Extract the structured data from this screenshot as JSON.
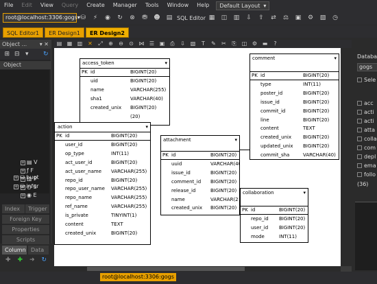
{
  "menu": [
    "File",
    "Edit",
    "View",
    "Query",
    "Create",
    "Manager",
    "Tools",
    "Window",
    "Help"
  ],
  "menu_disabled": [
    false,
    true,
    false,
    true,
    false,
    false,
    false,
    false,
    false
  ],
  "layout_select": "Default Layout",
  "connection": "root@localhost:3306:gogs",
  "sql_editor_label": "SQL Editor",
  "tabs": [
    "SQL Editor1",
    "ER Design1",
    "ER Design2"
  ],
  "object_panel": {
    "title": "Object ...",
    "tree_header": "Object",
    "tree_items": [
      "V",
      "F",
      "P",
      "S",
      "E",
      "bugt",
      "infor"
    ],
    "tabs": [
      "Index",
      "Trigger",
      "Foreign Key",
      "Properties",
      "Scripts"
    ],
    "bottom_tabs": [
      "Column",
      "Data"
    ]
  },
  "entities": [
    {
      "name": "access_token",
      "pk": {
        "name": "id",
        "type": "BIGINT(20)"
      },
      "columns": [
        {
          "name": "uid",
          "type": "BIGINT(20)"
        },
        {
          "name": "name",
          "type": "VARCHAR(255)"
        },
        {
          "name": "sha1",
          "type": "VARCHAR(40)"
        },
        {
          "name": "created_unix",
          "type": "BIGINT(20)"
        },
        {
          "name": "",
          "type": "(20)"
        }
      ]
    },
    {
      "name": "action",
      "pk": {
        "name": "id",
        "type": "BIGINT(20)"
      },
      "columns": [
        {
          "name": "user_id",
          "type": "BIGINT(20)"
        },
        {
          "name": "op_type",
          "type": "INT(11)"
        },
        {
          "name": "act_user_id",
          "type": "BIGINT(20)"
        },
        {
          "name": "act_user_name",
          "type": "VARCHAR(255)"
        },
        {
          "name": "repo_id",
          "type": "BIGINT(20)"
        },
        {
          "name": "repo_user_name",
          "type": "VARCHAR(255)"
        },
        {
          "name": "repo_name",
          "type": "VARCHAR(255)"
        },
        {
          "name": "ref_name",
          "type": "VARCHAR(255)"
        },
        {
          "name": "is_private",
          "type": "TINYINT(1)"
        },
        {
          "name": "content",
          "type": "TEXT"
        },
        {
          "name": "created_unix",
          "type": "BIGINT(20)"
        }
      ]
    },
    {
      "name": "comment",
      "pk": {
        "name": "id",
        "type": "BIGINT(20)"
      },
      "columns": [
        {
          "name": "type",
          "type": "INT(11)"
        },
        {
          "name": "poster_id",
          "type": "BIGINT(20)"
        },
        {
          "name": "issue_id",
          "type": "BIGINT(20)"
        },
        {
          "name": "commit_id",
          "type": "BIGINT(20)"
        },
        {
          "name": "line",
          "type": "BIGINT(20)"
        },
        {
          "name": "content",
          "type": "TEXT"
        },
        {
          "name": "created_unix",
          "type": "BIGINT(20)"
        },
        {
          "name": "updated_unix",
          "type": "BIGINT(20)"
        },
        {
          "name": "commit_sha",
          "type": "VARCHAR(40)"
        }
      ]
    },
    {
      "name": "attachment",
      "pk": {
        "name": "id",
        "type": "BIGINT(20)"
      },
      "columns": [
        {
          "name": "uuid",
          "type": "VARCHAR(40)"
        },
        {
          "name": "issue_id",
          "type": "BIGINT(20)"
        },
        {
          "name": "comment_id",
          "type": "BIGINT(20)"
        },
        {
          "name": "release_id",
          "type": "BIGINT(20)"
        },
        {
          "name": "name",
          "type": "VARCHAR(2"
        },
        {
          "name": "created_unix",
          "type": "BIGINT(20)"
        }
      ]
    },
    {
      "name": "collaboration",
      "pk": {
        "name": "id",
        "type": "BIGINT(20)"
      },
      "columns": [
        {
          "name": "repo_id",
          "type": "BIGINT(20)"
        },
        {
          "name": "user_id",
          "type": "BIGINT(20)"
        },
        {
          "name": "mode",
          "type": "INT(11)"
        }
      ]
    }
  ],
  "pk_label": "PK",
  "right_panel": {
    "title": "Databas",
    "db_name": "gogs",
    "select_label": "Sele",
    "items": [
      "acc",
      "acti",
      "acti",
      "atta",
      "colla",
      "com",
      "depl",
      "ema",
      "follo"
    ],
    "count": "(36)"
  }
}
